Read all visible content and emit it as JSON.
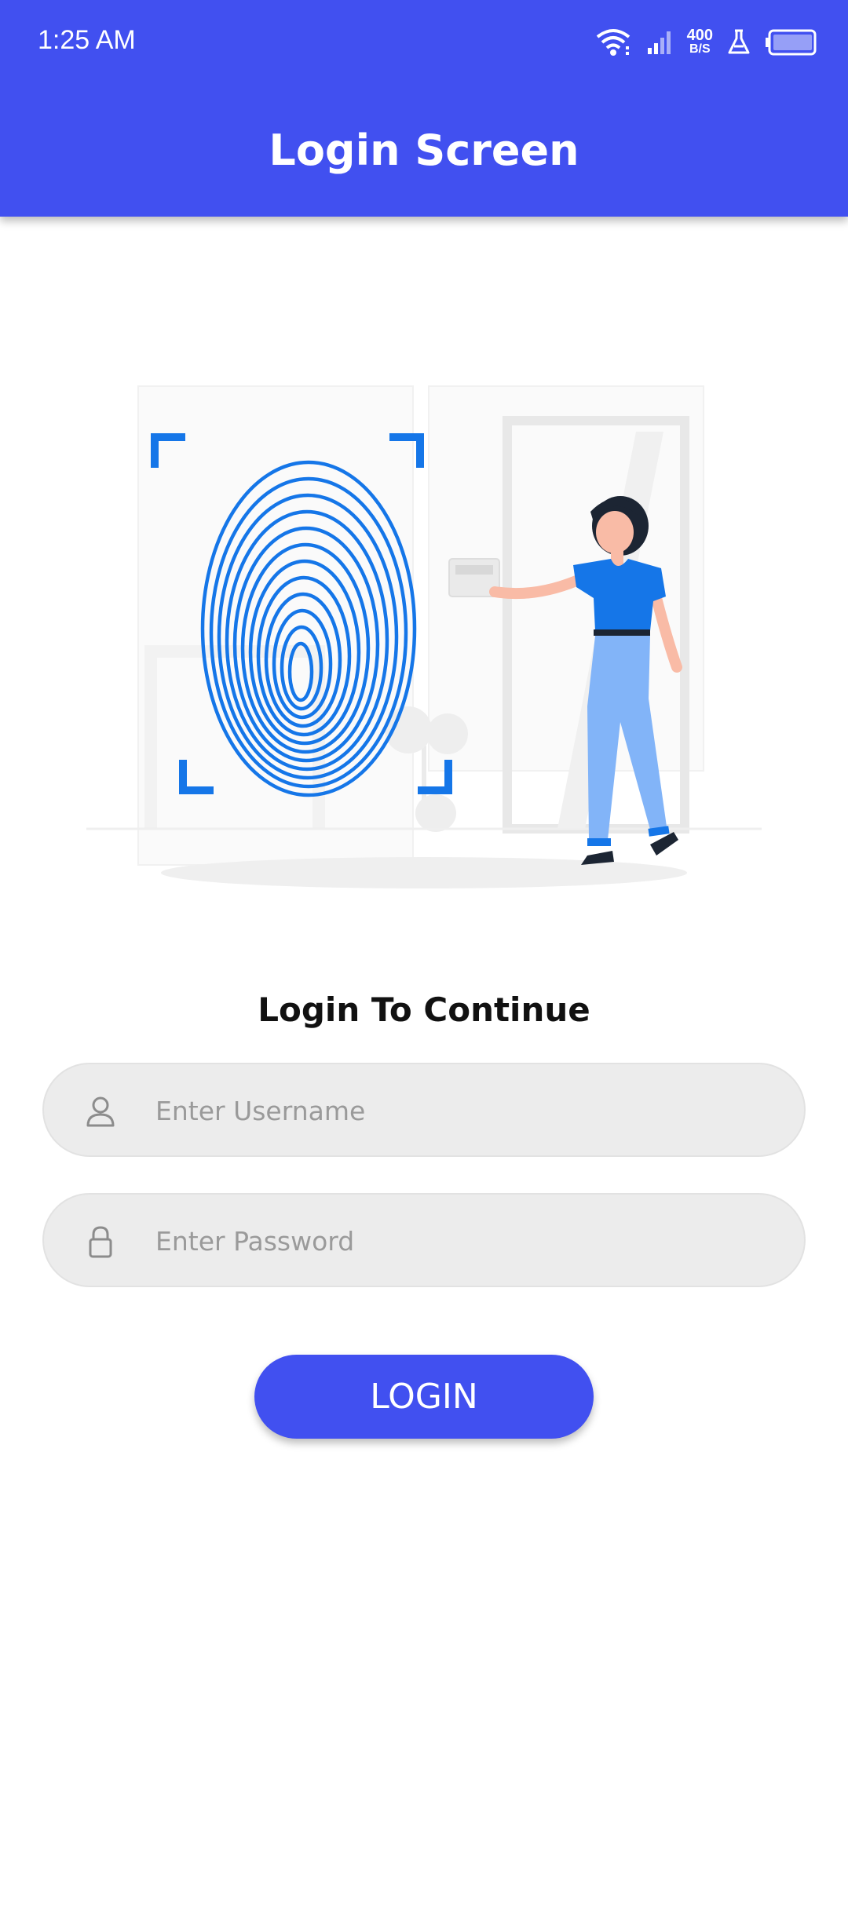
{
  "status_bar": {
    "time": "1:25 AM",
    "net_speed_value": "400",
    "net_speed_unit": "B/S",
    "icons": [
      "wifi-icon",
      "signal-icon",
      "lab-flask-icon",
      "battery-icon"
    ]
  },
  "header": {
    "title": "Login Screen",
    "background_color": "#4150F0"
  },
  "illustration": {
    "subject": "fingerprint-scan-illustration",
    "accent_color": "#1576E8"
  },
  "form": {
    "heading": "Login To Continue",
    "username": {
      "placeholder": "Enter Username",
      "value": ""
    },
    "password": {
      "placeholder": "Enter Password",
      "value": ""
    },
    "login_label": "LOGIN",
    "button_color": "#4150F0"
  }
}
